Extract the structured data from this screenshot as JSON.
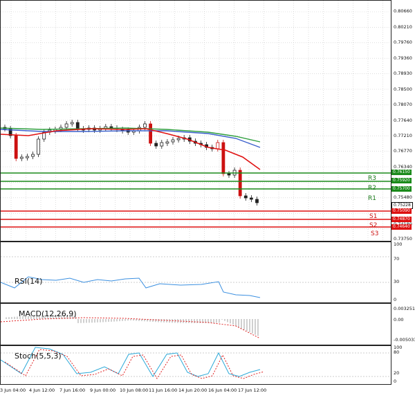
{
  "main": {
    "price_labels": [
      "0.80660",
      "0.80210",
      "0.79760",
      "0.79360",
      "0.78930",
      "0.78500",
      "0.78070",
      "0.77640",
      "0.77210",
      "0.76770",
      "0.76340",
      "0.75480",
      "0.74180",
      "0.73750"
    ],
    "levels": [
      {
        "label": "R3",
        "price": "0.76150",
        "kind": "r"
      },
      {
        "label": "R2",
        "price": "0.75920",
        "kind": "r"
      },
      {
        "label": "R1",
        "price": "0.75700",
        "kind": "r"
      },
      {
        "label": "S1",
        "price": "0.75090",
        "kind": "s"
      },
      {
        "label": "S2",
        "price": "0.74870",
        "kind": "s"
      },
      {
        "label": "S3",
        "price": "0.74640",
        "kind": "s"
      }
    ],
    "current_price": "0.75228"
  },
  "rsi": {
    "title": "RSI(14)",
    "labels": [
      "100",
      "70",
      "30",
      "0"
    ]
  },
  "macd": {
    "title": "MACD(12,26,9)",
    "labels": [
      "0.003251",
      "0.00",
      "-0.005033"
    ]
  },
  "stoch": {
    "title": "Stoch(5,5,3)",
    "labels": [
      "100",
      "80",
      "20",
      "0"
    ]
  },
  "time_labels": [
    "3 Jun 04:00",
    "4 Jun 12:00",
    "7 Jun 16:00",
    "9 Jun 00:00",
    "10 Jun 08:00",
    "11 Jun 16:00",
    "14 Jun 20:00",
    "16 Jun 04:00",
    "17 Jun 12:00"
  ],
  "colors": {
    "resistance": "#1a8a1a",
    "support": "#dd1111",
    "ma_fast": "#e01010",
    "ma_mid": "#3a5fcc",
    "ma_slow": "#2e9e3e",
    "rsi": "#3a8fe0",
    "stoch_main": "#2aa8d8",
    "stoch_signal": "#e02020",
    "macd": "#888888"
  }
}
